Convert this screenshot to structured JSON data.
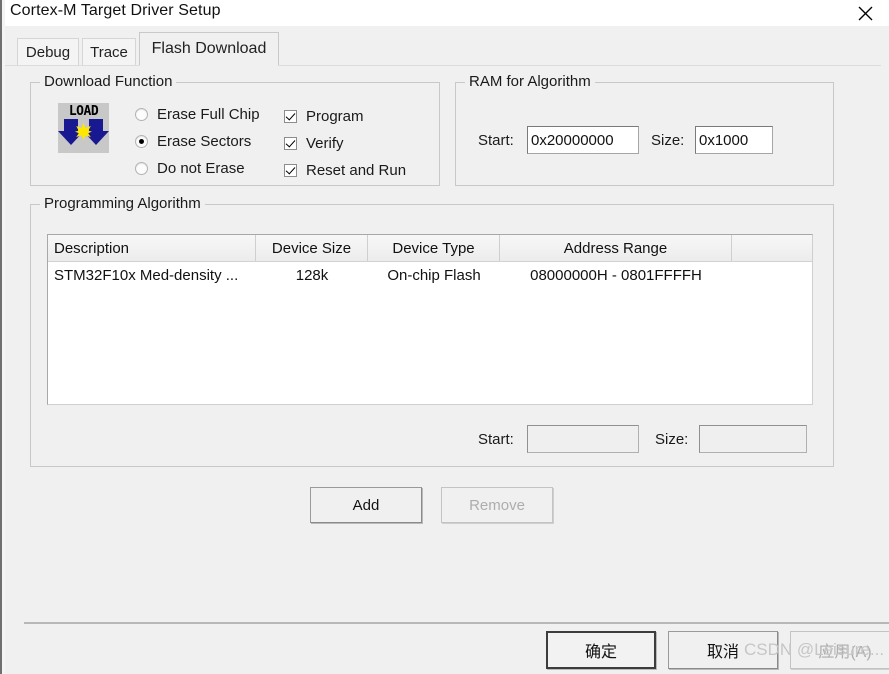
{
  "window": {
    "title": "Cortex-M Target Driver Setup",
    "close_icon": "close-icon"
  },
  "tabs": [
    {
      "label": "Debug",
      "active": false
    },
    {
      "label": "Trace",
      "active": false
    },
    {
      "label": "Flash Download",
      "active": true
    }
  ],
  "download_function": {
    "title": "Download Function",
    "icon_text": "LOAD",
    "erase_options": [
      {
        "label": "Erase Full Chip",
        "selected": false
      },
      {
        "label": "Erase Sectors",
        "selected": true
      },
      {
        "label": "Do not Erase",
        "selected": false
      }
    ],
    "checkboxes": [
      {
        "label": "Program",
        "checked": true
      },
      {
        "label": "Verify",
        "checked": true
      },
      {
        "label": "Reset and Run",
        "checked": true
      }
    ]
  },
  "ram_for_algorithm": {
    "title": "RAM for Algorithm",
    "start_label": "Start:",
    "start_value": "0x20000000",
    "size_label": "Size:",
    "size_value": "0x1000"
  },
  "programming_algorithm": {
    "title": "Programming Algorithm",
    "columns": [
      "Description",
      "Device Size",
      "Device Type",
      "Address Range",
      ""
    ],
    "rows": [
      {
        "description": "STM32F10x Med-density ...",
        "device_size": "128k",
        "device_type": "On-chip Flash",
        "address_range": "08000000H - 0801FFFFH",
        "extra": ""
      }
    ],
    "start_label": "Start:",
    "start_value": "",
    "size_label": "Size:",
    "size_value": "",
    "add_label": "Add",
    "remove_label": "Remove"
  },
  "dialog_buttons": {
    "ok": "确定",
    "cancel": "取消",
    "apply": "应用(A)"
  },
  "watermark": "CSDN @Leisure...",
  "colors": {
    "dialog_bg": "#f0f0f0",
    "titlebar_bg": "#ffffff",
    "listview_bg": "#ffffff",
    "icon_arrow": "#181890",
    "icon_star": "#ffe800",
    "icon_plate": "#c8c8c8",
    "disabled_text": "#adadad"
  }
}
